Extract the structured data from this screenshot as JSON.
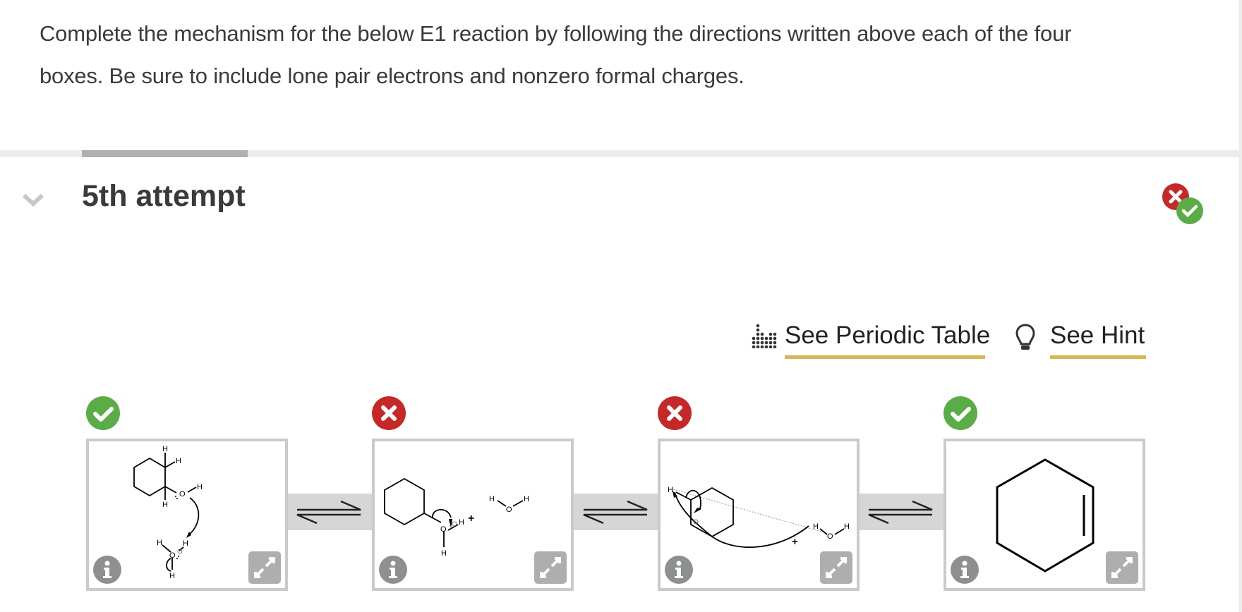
{
  "question": {
    "text": "Complete the mechanism for the below E1 reaction by following the directions written above each of the four boxes. Be sure to include lone pair electrons and nonzero formal charges."
  },
  "attempt": {
    "title": "5th attempt",
    "overall_status": "partially-correct"
  },
  "links": {
    "periodic_table": {
      "label": "See Periodic Table",
      "icon": "periodic-table-icon"
    },
    "hint": {
      "label": "See Hint",
      "icon": "lightbulb-icon"
    }
  },
  "colors": {
    "correct": "#5aac46",
    "incorrect": "#c62828",
    "link_underline": "#d6b656",
    "box_border": "#cacaca",
    "connector": "#d6d6d6"
  },
  "steps": [
    {
      "status": "correct",
      "status_icon": "check-icon",
      "description": "Protonation of cyclohexanol by hydronium",
      "labels": {
        "h_top": "H",
        "h_right": "H",
        "h_bottom": "H",
        "oh_h": "H",
        "o": "O",
        "h3o_h_left": "H",
        "h3o_h_right": "H",
        "h3o_h_bottom": "H",
        "o2": "O"
      }
    },
    {
      "status": "incorrect",
      "status_icon": "x-icon",
      "description": "Loss of water to form carbocation",
      "labels": {
        "o": "O",
        "h_right": "H",
        "h_bottom": "H",
        "plus": "+",
        "water_h_left": "H",
        "water_o": "O",
        "water_h_right": "H"
      }
    },
    {
      "status": "incorrect",
      "status_icon": "x-icon",
      "description": "Deprotonation by water",
      "labels": {
        "h_left": "H",
        "plus": "+",
        "water_h_left": "H",
        "water_o": "O",
        "water_h_right": "H"
      }
    },
    {
      "status": "correct",
      "status_icon": "check-icon",
      "description": "Cyclohexene product"
    }
  ],
  "box_controls": {
    "info_icon": "info-icon",
    "expand_icon": "expand-icon"
  }
}
